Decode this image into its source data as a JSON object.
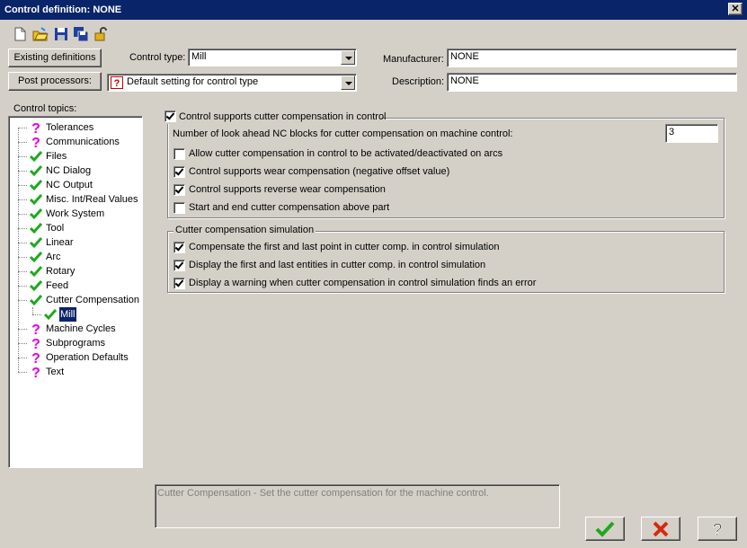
{
  "window": {
    "title": "Control definition: NONE",
    "close_glyph": "✕"
  },
  "toolbar": {
    "icons": [
      "new-file-icon",
      "open-folder-icon",
      "save-icon",
      "save-as-icon",
      "unlock-icon"
    ]
  },
  "top": {
    "existing_definitions_label": "Existing definitions",
    "post_processors_label": "Post processors:",
    "control_type_label": "Control type:",
    "control_type_value": "Mill",
    "post_processor_value": "Default setting for control type",
    "manufacturer_label": "Manufacturer:",
    "manufacturer_value": "NONE",
    "description_label": "Description:",
    "description_value": "NONE"
  },
  "topics": {
    "label": "Control topics:",
    "items": [
      {
        "label": "Tolerances",
        "icon": "question"
      },
      {
        "label": "Communications",
        "icon": "question"
      },
      {
        "label": "Files",
        "icon": "check"
      },
      {
        "label": "NC Dialog",
        "icon": "check"
      },
      {
        "label": "NC Output",
        "icon": "check"
      },
      {
        "label": "Misc. Int/Real Values",
        "icon": "check"
      },
      {
        "label": "Work System",
        "icon": "check"
      },
      {
        "label": "Tool",
        "icon": "check"
      },
      {
        "label": "Linear",
        "icon": "check"
      },
      {
        "label": "Arc",
        "icon": "check"
      },
      {
        "label": "Rotary",
        "icon": "check"
      },
      {
        "label": "Feed",
        "icon": "check"
      },
      {
        "label": "Cutter Compensation",
        "icon": "check"
      },
      {
        "label": "Mill",
        "icon": "check"
      },
      {
        "label": "Machine Cycles",
        "icon": "question"
      },
      {
        "label": "Subprograms",
        "icon": "question"
      },
      {
        "label": "Operation Defaults",
        "icon": "question"
      },
      {
        "label": "Text",
        "icon": "question"
      }
    ]
  },
  "cutter": {
    "supports_label": "Control supports cutter compensation in control",
    "supports_checked": true,
    "lookahead_label": "Number of look ahead NC blocks for cutter compensation on machine control:",
    "lookahead_value": "3",
    "options": [
      {
        "label": "Allow cutter compensation in control to be activated/deactivated on arcs",
        "checked": false
      },
      {
        "label": "Control supports wear compensation (negative offset value)",
        "checked": true
      },
      {
        "label": "Control supports reverse wear compensation",
        "checked": true
      },
      {
        "label": "Start and end cutter compensation above part",
        "checked": false
      }
    ],
    "sim_title": "Cutter compensation simulation",
    "sim_options": [
      {
        "label": "Compensate the first and last point in cutter comp. in control simulation",
        "checked": true
      },
      {
        "label": "Display the first and last entities in cutter comp. in control simulation",
        "checked": true
      },
      {
        "label": "Display a warning when cutter compensation in control simulation finds an error",
        "checked": true
      }
    ]
  },
  "status": {
    "text": "Cutter Compensation - Set the cutter compensation for the machine control."
  },
  "footer": {
    "ok_icon": "checkmark-icon",
    "cancel_icon": "x-icon",
    "help_icon": "help-icon"
  },
  "colors": {
    "check": "#1fa81f",
    "question": "#e000e0",
    "cancel": "#d42a10",
    "selection": "#0a246a"
  }
}
